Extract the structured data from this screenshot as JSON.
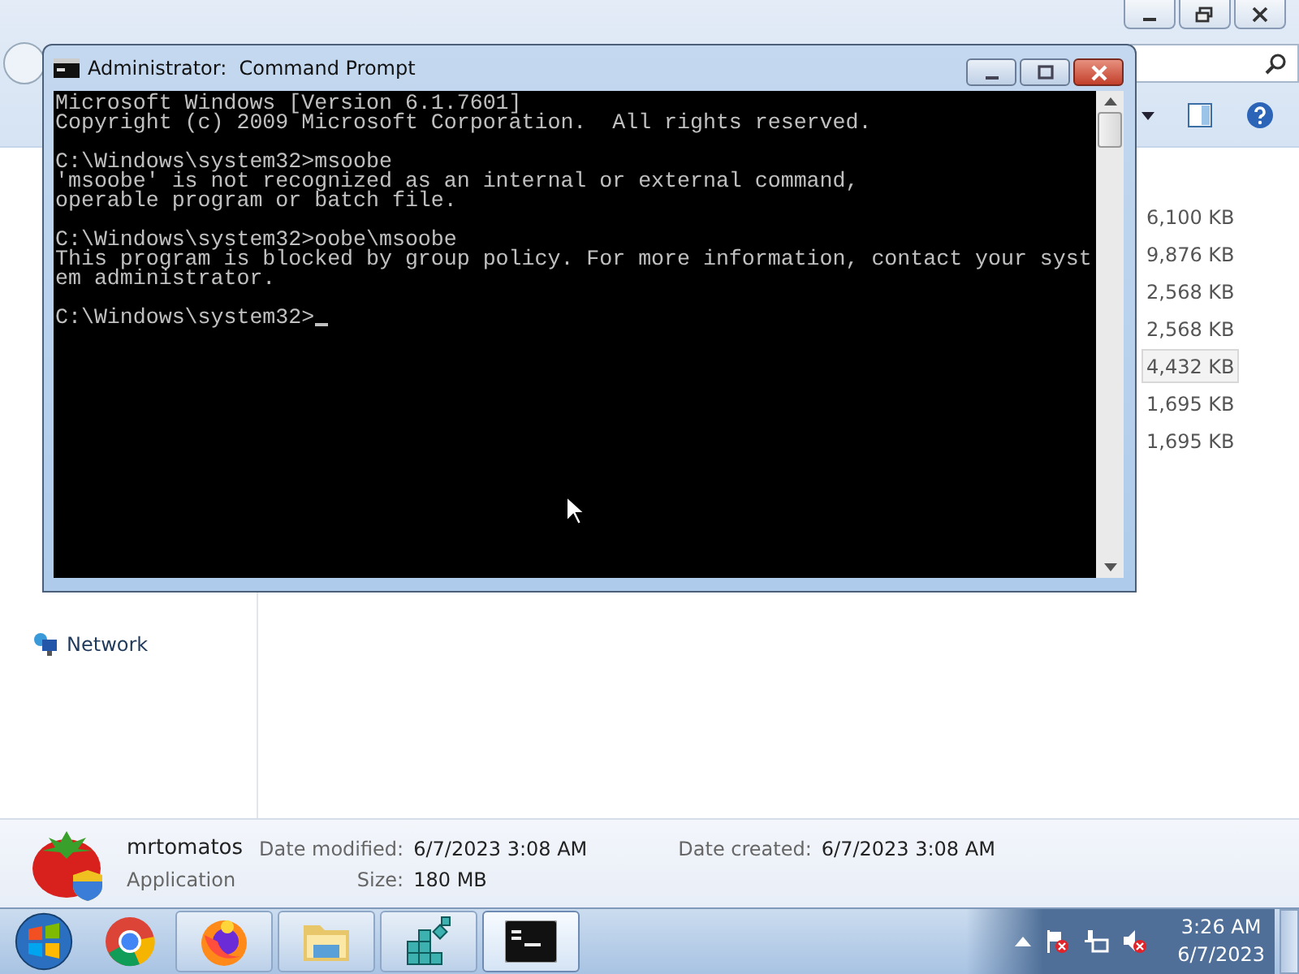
{
  "explorer": {
    "sizes": [
      {
        "text": "6,100 KB",
        "selected": false
      },
      {
        "text": "9,876 KB",
        "selected": false
      },
      {
        "text": "2,568 KB",
        "selected": false
      },
      {
        "text": "2,568 KB",
        "selected": false
      },
      {
        "text": "4,432 KB",
        "selected": true
      },
      {
        "text": "1,695 KB",
        "selected": false
      },
      {
        "text": "1,695 KB",
        "selected": false
      }
    ],
    "nav_items": [
      {
        "label": "Network"
      }
    ],
    "details": {
      "name": "mrtomatos",
      "type": "Application",
      "fields": [
        {
          "label": "Date modified:",
          "value": "6/7/2023 3:08 AM"
        },
        {
          "label": "Size:",
          "value": "180 MB"
        },
        {
          "label": "Date created:",
          "value": "6/7/2023 3:08 AM"
        }
      ]
    }
  },
  "console_window": {
    "title": "Administrator:  Command Prompt",
    "blocks": [
      {
        "lines": [
          "Microsoft Windows [Version 6.1.7601]",
          "Copyright (c) 2009 Microsoft Corporation.  All rights reserved."
        ]
      },
      {
        "lines": [
          "C:\\Windows\\system32>msoobe",
          "'msoobe' is not recognized as an internal or external command,",
          "operable program or batch file."
        ]
      },
      {
        "lines": [
          "C:\\Windows\\system32>oobe\\msoobe",
          "This program is blocked by group policy. For more information, contact your syst",
          "em administrator."
        ]
      },
      {
        "lines": [
          "C:\\Windows\\system32>"
        ]
      }
    ],
    "cursor": true
  },
  "taskbar": {
    "items": [
      {
        "kind": "browser-round",
        "selected": false
      },
      {
        "kind": "fox",
        "selected": false
      },
      {
        "kind": "folder",
        "selected": false
      },
      {
        "kind": "cubes",
        "selected": false
      },
      {
        "kind": "console",
        "selected": true
      }
    ],
    "clock": {
      "time": "3:26 AM",
      "date": "6/7/2023"
    }
  }
}
